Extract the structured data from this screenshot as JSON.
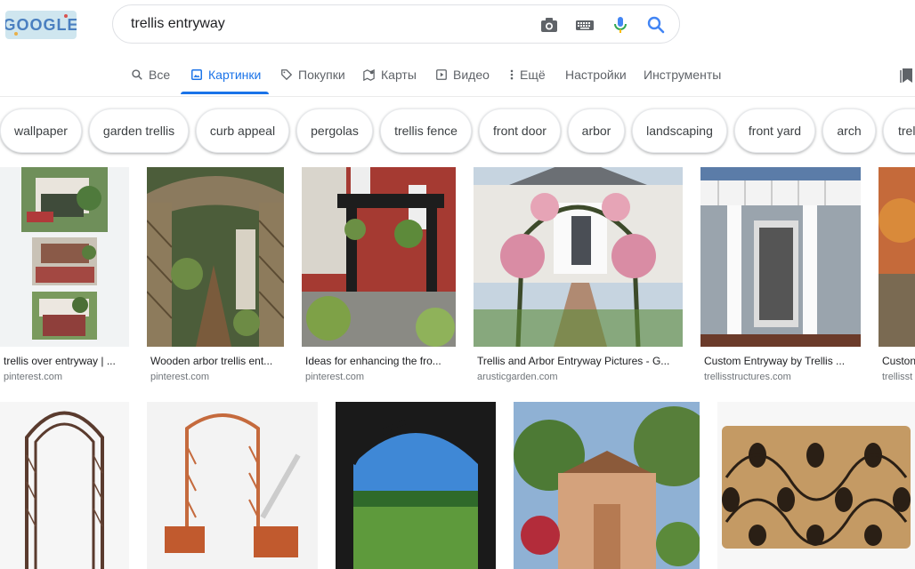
{
  "logo_text": "GOOGLE",
  "search": {
    "query": "trellis entryway"
  },
  "tabs": [
    {
      "label": "Все",
      "icon": "search-icon"
    },
    {
      "label": "Картинки",
      "icon": "image-icon",
      "active": true
    },
    {
      "label": "Покупки",
      "icon": "tag-icon"
    },
    {
      "label": "Карты",
      "icon": "map-icon"
    },
    {
      "label": "Видео",
      "icon": "play-icon"
    },
    {
      "label": "Ещё",
      "icon": "more-vert-icon"
    },
    {
      "label": "Настройки"
    },
    {
      "label": "Инструменты"
    }
  ],
  "chips": [
    "wallpaper",
    "garden trellis",
    "curb appeal",
    "pergolas",
    "trellis fence",
    "front door",
    "arbor",
    "landscaping",
    "front yard",
    "arch",
    "trel"
  ],
  "results_row1": [
    {
      "title": "trellis over entryway | ...",
      "source": "pinterest.com"
    },
    {
      "title": "Wooden arbor trellis ent...",
      "source": "pinterest.com"
    },
    {
      "title": "Ideas for enhancing the fro...",
      "source": "pinterest.com"
    },
    {
      "title": "Trellis and Arbor Entryway Pictures - G...",
      "source": "arusticgarden.com"
    },
    {
      "title": "Custom Entryway by Trellis ...",
      "source": "trellisstructures.com"
    },
    {
      "title": "Custon",
      "source": "trellisst"
    }
  ],
  "colors": {
    "accent": "#1a73e8",
    "text": "#202124",
    "muted": "#5f6368"
  }
}
